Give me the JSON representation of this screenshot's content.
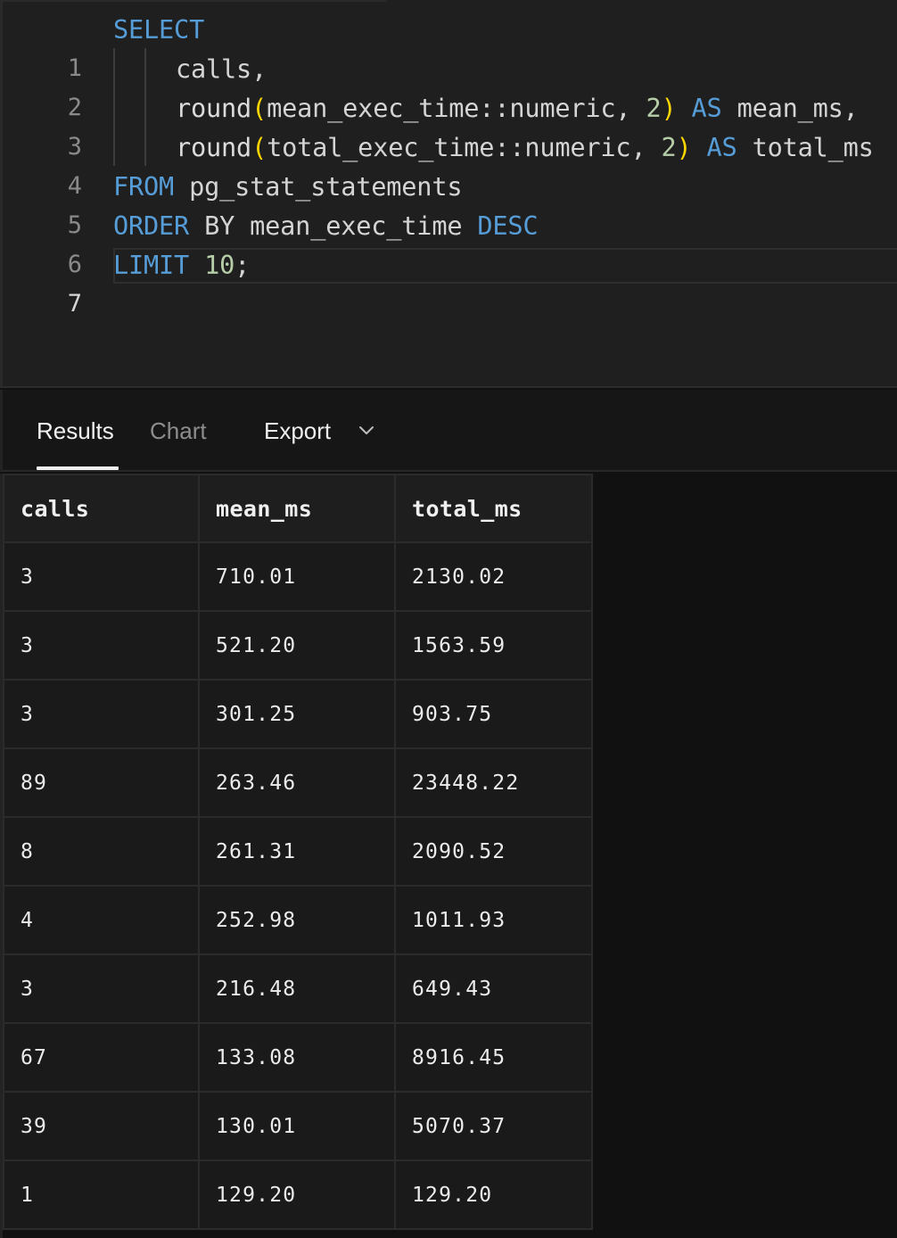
{
  "editor": {
    "lines": [
      {
        "number": "1"
      },
      {
        "number": "2"
      },
      {
        "number": "3"
      },
      {
        "number": "4"
      },
      {
        "number": "5"
      },
      {
        "number": "6"
      },
      {
        "number": "7"
      }
    ],
    "tokens": {
      "l1_select": "SELECT",
      "l2_calls": "calls,",
      "l3_round": "round",
      "l3_open": "(",
      "l3_arg": "mean_exec_time::numeric, ",
      "l3_num": "2",
      "l3_close": ")",
      "l3_as": "AS",
      "l3_alias": "mean_ms,",
      "l4_round": "round",
      "l4_open": "(",
      "l4_arg": "total_exec_time::numeric, ",
      "l4_num": "2",
      "l4_close": ")",
      "l4_as": "AS",
      "l4_alias": "total_ms",
      "l5_from": "FROM",
      "l5_table": "pg_stat_statements",
      "l6_order": "ORDER",
      "l6_by": "BY",
      "l6_col": "mean_exec_time",
      "l6_desc": "DESC",
      "l7_limit": "LIMIT",
      "l7_num": "10",
      "l7_semi": ";"
    },
    "active_line": "7"
  },
  "results": {
    "tabs": {
      "results": "Results",
      "chart": "Chart",
      "export": "Export"
    },
    "active_tab": "Results",
    "columns": [
      "calls",
      "mean_ms",
      "total_ms"
    ],
    "rows": [
      [
        "3",
        "710.01",
        "2130.02"
      ],
      [
        "3",
        "521.20",
        "1563.59"
      ],
      [
        "3",
        "301.25",
        "903.75"
      ],
      [
        "89",
        "263.46",
        "23448.22"
      ],
      [
        "8",
        "261.31",
        "2090.52"
      ],
      [
        "4",
        "252.98",
        "1011.93"
      ],
      [
        "3",
        "216.48",
        "649.43"
      ],
      [
        "67",
        "133.08",
        "8916.45"
      ],
      [
        "39",
        "130.01",
        "5070.37"
      ],
      [
        "1",
        "129.20",
        "129.20"
      ]
    ]
  },
  "icons": {
    "export_dropdown": "chevron-down-icon"
  },
  "colors": {
    "keyword": "#569cd6",
    "number": "#b5cea8",
    "bracket": "#ffd700",
    "editor_bg": "#1f1f1f",
    "grid_bg": "#1a1a1a"
  }
}
